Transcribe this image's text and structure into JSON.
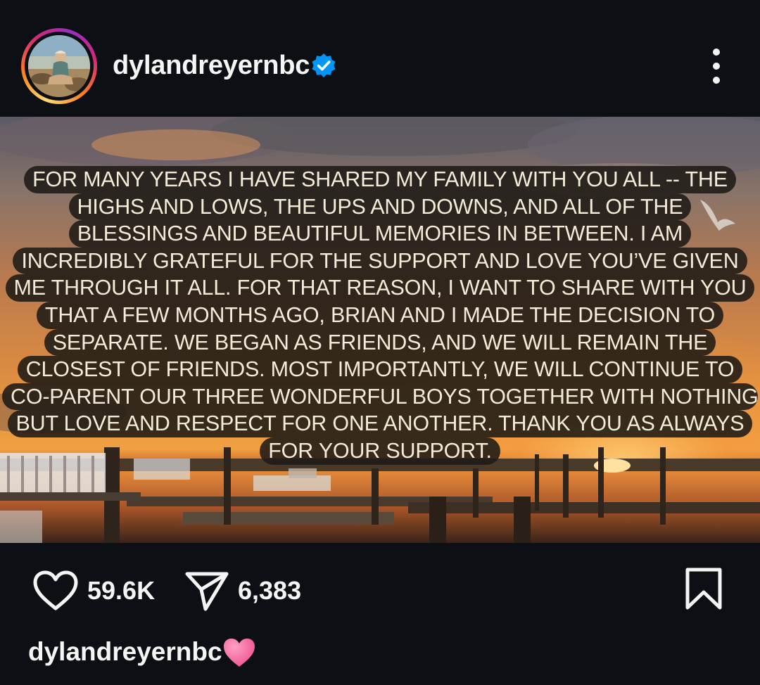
{
  "header": {
    "username": "dylandreyernbc",
    "verified_badge": "verified-badge-icon",
    "more_icon": "vertical-ellipsis-icon"
  },
  "post": {
    "image_description_icon": "sunset-marina-photo",
    "story_lines": [
      "FOR MANY YEARS I HAVE SHARED MY FAMILY WITH YOU ALL -- THE",
      "HIGHS AND LOWS, THE UPS AND DOWNS, AND ALL OF THE",
      "BLESSINGS AND BEAUTIFUL MEMORIES IN BETWEEN. I AM",
      "INCREDIBLY GRATEFUL FOR THE SUPPORT AND LOVE YOU’VE GIVEN",
      "ME THROUGH IT ALL. FOR THAT REASON, I WANT TO SHARE WITH YOU",
      "THAT A FEW MONTHS AGO, BRIAN AND I MADE THE DECISION TO",
      "SEPARATE. WE BEGAN AS FRIENDS, AND WE WILL REMAIN THE",
      "CLOSEST OF FRIENDS.  MOST IMPORTANTLY, WE WILL CONTINUE TO",
      "CO-PARENT OUR THREE WONDERFUL BOYS TOGETHER WITH NOTHING",
      "BUT LOVE AND RESPECT FOR ONE ANOTHER.  THANK YOU AS ALWAYS",
      "FOR YOUR SUPPORT."
    ]
  },
  "actions": {
    "like_icon": "heart-outline-icon",
    "likes": "59.6K",
    "share_icon": "paper-plane-icon",
    "shares": "6,383",
    "save_icon": "bookmark-icon"
  },
  "caption": {
    "username": "dylandreyernbc",
    "emoji_icon": "pink-heart-emoji"
  },
  "colors": {
    "background": "#0c1014",
    "text": "#f5f5f5",
    "verified_blue": "#0095f6",
    "caption_heart": "#f25c9a"
  }
}
